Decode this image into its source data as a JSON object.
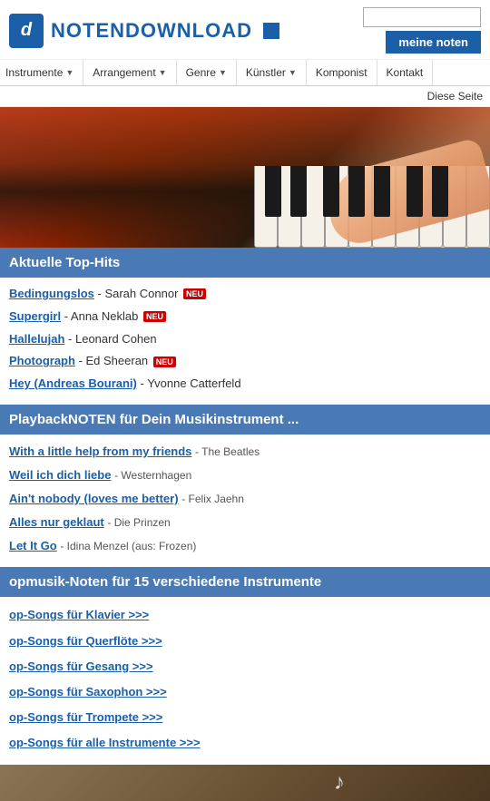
{
  "header": {
    "logo_text": "NOTENDOWNLOAD",
    "meine_noten_label": "meine noten",
    "search_placeholder": ""
  },
  "nav": {
    "items": [
      {
        "label": "Instrumente",
        "has_arrow": true
      },
      {
        "label": "Arrangement",
        "has_arrow": true
      },
      {
        "label": "Genre",
        "has_arrow": true
      },
      {
        "label": "Künstler",
        "has_arrow": true
      },
      {
        "label": "Komponist",
        "has_arrow": false
      },
      {
        "label": "Kontakt",
        "has_arrow": false
      }
    ]
  },
  "diese_seite": "Diese Seite",
  "sections": {
    "top_hits": {
      "header": "Aktuelle Top-Hits",
      "items": [
        {
          "title": "Bedingungslos",
          "artist": "Sarah Connor",
          "badge": "NEU"
        },
        {
          "title": "Supergirl",
          "artist": "Anna Neklab",
          "badge": "NEU"
        },
        {
          "title": "Hallelujah",
          "artist": "Leonard Cohen",
          "badge": null
        },
        {
          "title": "Photograph",
          "artist": "Ed Sheeran",
          "badge": "NEU"
        },
        {
          "title": "Hey (Andreas Bourani)",
          "artist": "Yvonne Catterfeld",
          "badge": null
        }
      ]
    },
    "playback": {
      "header": "PlaybackNOTEN für Dein Musikinstrument ...",
      "items": [
        {
          "title": "With a little help from my friends",
          "artist": "The Beatles"
        },
        {
          "title": "Weil ich dich liebe",
          "artist": "Westernhagen"
        },
        {
          "title": "Ain't nobody (loves me better)",
          "artist": "Felix Jaehn"
        },
        {
          "title": "Alles nur geklaut",
          "artist": "Die Prinzen"
        },
        {
          "title": "Let It Go",
          "artist": "Idina Menzel (aus: Frozen)"
        }
      ]
    },
    "instruments": {
      "header": "opmusik-Noten für 15 verschiedene Instrumente",
      "items": [
        {
          "label": "op-Songs für Klavier >>>"
        },
        {
          "label": "op-Songs für Querflöte >>>"
        },
        {
          "label": "op-Songs für Gesang >>>"
        },
        {
          "label": "op-Songs für Saxophon >>>"
        },
        {
          "label": "op-Songs für Trompete >>>"
        },
        {
          "label": "op-Songs für alle Instrumente >>>"
        }
      ]
    }
  }
}
